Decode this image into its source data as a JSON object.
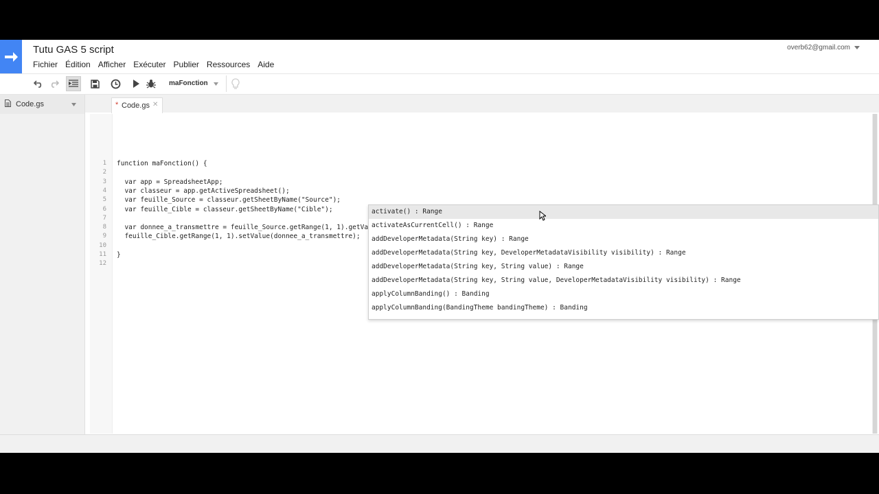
{
  "header": {
    "title": "Tutu GAS 5 script",
    "account": "overb62@gmail.com"
  },
  "menu": [
    "Fichier",
    "Édition",
    "Afficher",
    "Exécuter",
    "Publier",
    "Ressources",
    "Aide"
  ],
  "toolbar": {
    "function_select": "maFonction",
    "icons": [
      "undo-icon",
      "redo-icon",
      "indent-icon",
      "save-icon",
      "clock-icon",
      "run-icon",
      "debug-icon",
      "lightbulb-icon"
    ]
  },
  "sidebar": {
    "file": "Code.gs"
  },
  "tab": {
    "name": "Code.gs",
    "modified_marker": "*"
  },
  "code": {
    "line_numbers": [
      "1",
      "2",
      "3",
      "4",
      "5",
      "6",
      "7",
      "8",
      "9",
      "10",
      "11",
      "12"
    ],
    "lines": [
      "function maFonction() {",
      "",
      "  var app = SpreadsheetApp;",
      "  var classeur = app.getActiveSpreadsheet();",
      "  var feuille_Source = classeur.getSheetByName(\"Source\");",
      "  var feuille_Cible = classeur.getSheetByName(\"Cible\");",
      "",
      "  var donnee_a_transmettre = feuille_Source.getRange(1, 1).getValue();",
      "  feuille_Cible.getRange(1, 1).setValue(donnee_a_transmettre);",
      "",
      "}",
      ""
    ]
  },
  "autocomplete": {
    "items": [
      "activate() : Range",
      "activateAsCurrentCell() : Range",
      "addDeveloperMetadata(String key) : Range",
      "addDeveloperMetadata(String key, DeveloperMetadataVisibility visibility) : Range",
      "addDeveloperMetadata(String key, String value) : Range",
      "addDeveloperMetadata(String key, String value, DeveloperMetadataVisibility visibility) : Range",
      "applyColumnBanding() : Banding",
      "applyColumnBanding(BandingTheme bandingTheme) : Banding"
    ],
    "selected_index": 0
  },
  "colors": {
    "logo": "#4285f4",
    "modified_star": "#d23f31",
    "variable": "#2a6aa8",
    "string": "#a33333"
  }
}
